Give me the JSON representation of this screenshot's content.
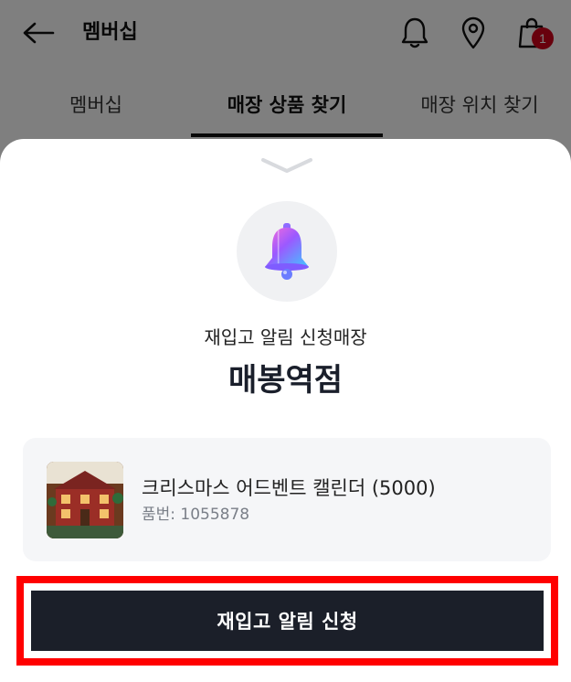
{
  "header": {
    "title": "멤버십",
    "back_icon": "arrow-left-icon",
    "icons": [
      "bell-icon",
      "location-pin-icon",
      "shopping-bag-icon"
    ],
    "cart_count": "1"
  },
  "tabs": [
    {
      "label": "멤버십",
      "active": false
    },
    {
      "label": "매장 상품 찾기",
      "active": true
    },
    {
      "label": "매장 위치 찾기",
      "active": false
    }
  ],
  "sheet": {
    "handle_icon": "chevron-down-icon",
    "hero_icon": "bell-icon",
    "subtitle": "재입고 알림 신청매장",
    "store_name": "매봉역점",
    "product": {
      "name": "크리스마스 어드벤트 캘린더 (5000)",
      "code": "품번: 1055878"
    },
    "cta_label": "재입고 알림 신청"
  },
  "colors": {
    "cta_bg": "#1b1f29",
    "badge": "#d0021b",
    "highlight": "#ff0000",
    "card_bg": "#f5f6f8"
  }
}
